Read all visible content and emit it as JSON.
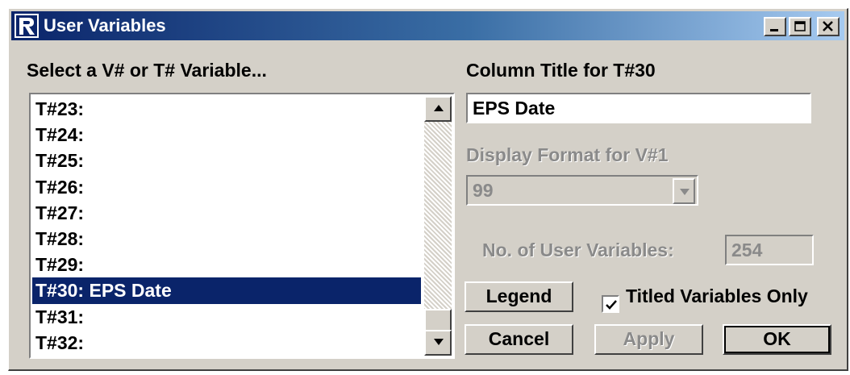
{
  "window": {
    "title": "User Variables",
    "icon": "app-r-icon",
    "controls": [
      "minimize-icon",
      "maximize-icon",
      "close-icon"
    ]
  },
  "list": {
    "heading": "Select a V# or T# Variable...",
    "items": [
      {
        "label": "T#23:",
        "selected": false
      },
      {
        "label": "T#24:",
        "selected": false
      },
      {
        "label": "T#25:",
        "selected": false
      },
      {
        "label": "T#26:",
        "selected": false
      },
      {
        "label": "T#27:",
        "selected": false
      },
      {
        "label": "T#28:",
        "selected": false
      },
      {
        "label": "T#29:",
        "selected": false
      },
      {
        "label": "T#30: EPS Date",
        "selected": true
      },
      {
        "label": "T#31:",
        "selected": false
      },
      {
        "label": "T#32:",
        "selected": false
      }
    ]
  },
  "column_title": {
    "label": "Column Title for T#30",
    "value": "EPS Date"
  },
  "display_format": {
    "label": "Display Format for V#1",
    "value": "99",
    "disabled": true
  },
  "user_var_count": {
    "label": "No. of User Variables:",
    "value": "254",
    "disabled": true
  },
  "buttons": {
    "legend": "Legend",
    "cancel": "Cancel",
    "apply": "Apply",
    "ok": "OK"
  },
  "titled_only": {
    "label": "Titled Variables Only",
    "checked": true
  },
  "colors": {
    "face": "#d4d0c8",
    "selection": "#0a246a",
    "title_gradient_start": "#0a246a",
    "title_gradient_end": "#a6caf0",
    "disabled_text": "#8a8a8a"
  }
}
